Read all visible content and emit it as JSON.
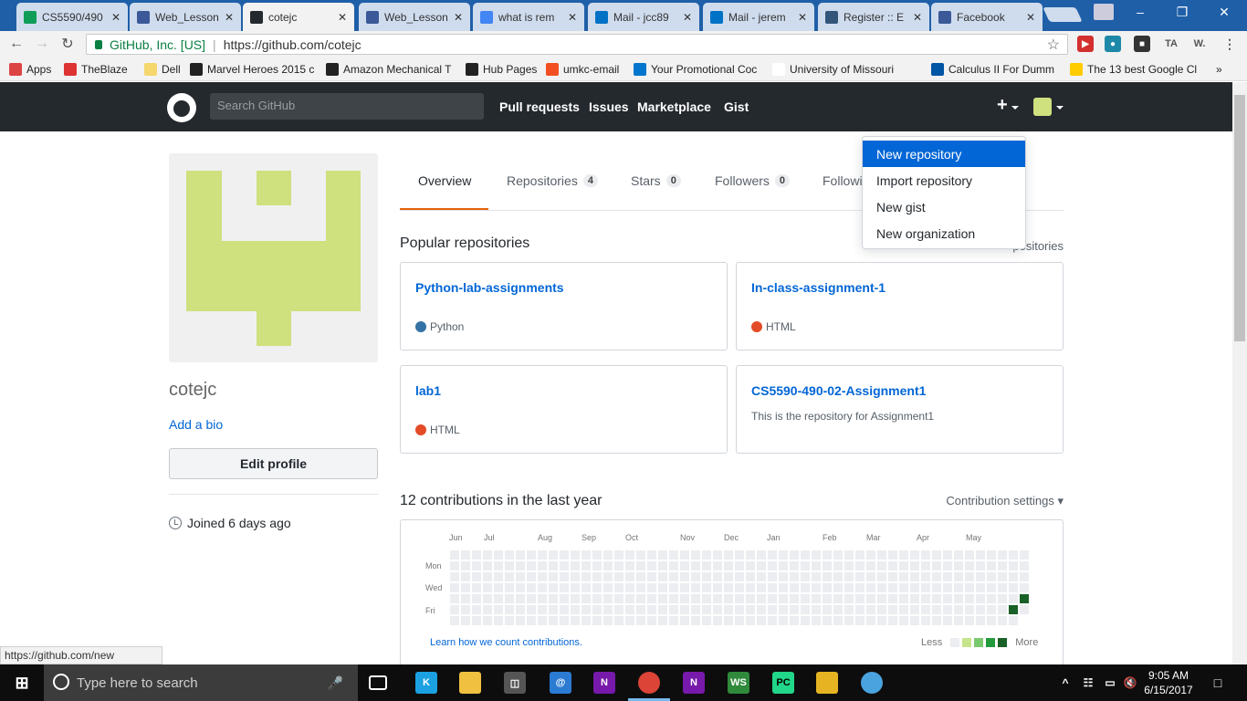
{
  "browser": {
    "tabs": [
      {
        "title": "CS5590/490",
        "icon": "sheets-icon",
        "color": "#0f9d58"
      },
      {
        "title": "Web_Lesson",
        "icon": "bootstrap-icon",
        "color": "#3b5998"
      },
      {
        "title": "cotejc",
        "icon": "github-icon",
        "color": "#24292e"
      },
      {
        "title": "Web_Lesson",
        "icon": "bootstrap-icon",
        "color": "#3b5998"
      },
      {
        "title": "what is rem",
        "icon": "google-icon",
        "color": "#4285f4"
      },
      {
        "title": "Mail - jcc89",
        "icon": "outlook-icon",
        "color": "#0072c6"
      },
      {
        "title": "Mail - jerem",
        "icon": "outlook-icon",
        "color": "#0072c6"
      },
      {
        "title": "Register :: E",
        "icon": "register-icon",
        "color": "#34557a"
      },
      {
        "title": "Facebook",
        "icon": "facebook-icon",
        "color": "#3b5998"
      }
    ],
    "address": {
      "secure_label": "GitHub, Inc. [US]",
      "url": "https://github.com/cotejc"
    },
    "extensions": [
      "TA",
      "W."
    ],
    "bookmarks": [
      {
        "label": "Apps",
        "icon": "apps-icon",
        "color": "#d44"
      },
      {
        "label": "TheBlaze",
        "icon": "b",
        "color": "#d33"
      },
      {
        "label": "Dell",
        "icon": "folder-icon",
        "color": "#f5d76e"
      },
      {
        "label": "Marvel Heroes 2015 c",
        "icon": "steam-icon",
        "color": "#222"
      },
      {
        "label": "Amazon Mechanical T",
        "icon": "amazon-icon",
        "color": "#222"
      },
      {
        "label": "Hub Pages",
        "icon": "h",
        "color": "#222"
      },
      {
        "label": "umkc-email",
        "icon": "ms-icon",
        "color": "#f25022"
      },
      {
        "label": "Your Promotional Coc",
        "icon": "dell-icon",
        "color": "#0076ce"
      },
      {
        "label": "University of Missouri",
        "icon": "page-icon",
        "color": "#fff"
      },
      {
        "label": "Calculus II For Dumm",
        "icon": "umkc-icon",
        "color": "#0055a4"
      },
      {
        "label": "The 13 best Google Cl",
        "icon": "d",
        "color": "#ffcc00"
      },
      {
        "label": "",
        "icon": "bi",
        "color": "#1a4f91"
      }
    ],
    "status_url": "https://github.com/new",
    "accent": "#1f5fa8"
  },
  "github": {
    "search_placeholder": "Search GitHub",
    "nav": [
      "Pull requests",
      "Issues",
      "Marketplace",
      "Gist"
    ],
    "plus": "+",
    "dropdown": [
      "New repository",
      "Import repository",
      "New gist",
      "New organization"
    ],
    "profile": {
      "username": "cotejc",
      "add_bio": "Add a bio",
      "edit_profile": "Edit profile",
      "joined": "Joined 6 days ago"
    },
    "tabs": [
      {
        "label": "Overview",
        "count": ""
      },
      {
        "label": "Repositories",
        "count": "4"
      },
      {
        "label": "Stars",
        "count": "0"
      },
      {
        "label": "Followers",
        "count": "0"
      },
      {
        "label": "Followi",
        "count": ""
      }
    ],
    "popular_title": "Popular repositories",
    "customize_label": "positories",
    "repos": [
      {
        "name": "Python-lab-assignments",
        "desc": "",
        "lang": "Python",
        "lang_color": "#3572a5"
      },
      {
        "name": "In-class-assignment-1",
        "desc": "",
        "lang": "HTML",
        "lang_color": "#e34c26"
      },
      {
        "name": "lab1",
        "desc": "",
        "lang": "HTML",
        "lang_color": "#e34c26"
      },
      {
        "name": "CS5590-490-02-Assignment1",
        "desc": "This is the repository for Assignment1",
        "lang": "",
        "lang_color": ""
      }
    ],
    "contrib_title": "12 contributions in the last year",
    "contrib_settings": "Contribution settings ▾",
    "months": [
      "Jun",
      "Jul",
      "Aug",
      "Sep",
      "Oct",
      "Nov",
      "Dec",
      "Jan",
      "Feb",
      "Mar",
      "Apr",
      "May"
    ],
    "days": [
      "Mon",
      "Wed",
      "Fri"
    ],
    "learn": "Learn how we count contributions.",
    "legend_less": "Less",
    "legend_more": "More",
    "legend_colors": [
      "#ebedf0",
      "#c6e48b",
      "#7bc96f",
      "#239a3b",
      "#196127"
    ]
  },
  "taskbar": {
    "search_placeholder": "Type here to search",
    "time": "9:05 AM",
    "date": "6/15/2017"
  }
}
